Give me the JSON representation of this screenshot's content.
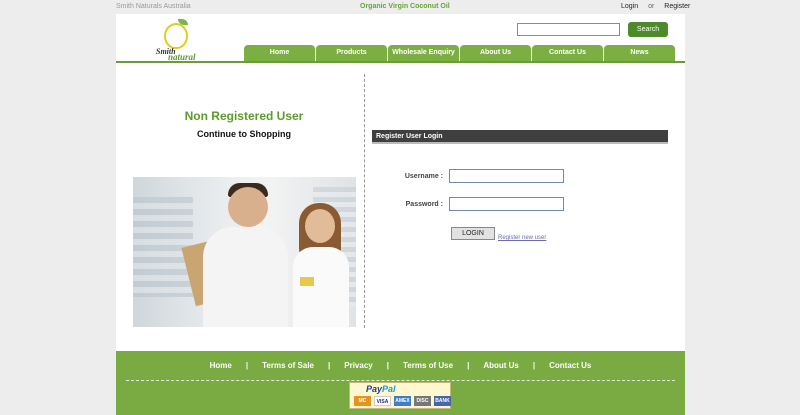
{
  "topbar": {
    "site_name": "Smith Naturals Australia",
    "tagline": "Organic Virgin Coconut Oil",
    "login": "Login",
    "or": "or",
    "register": "Register"
  },
  "logo": {
    "line1": "Smith",
    "line2": "natural"
  },
  "search": {
    "value": "",
    "placeholder": "",
    "button": "Search"
  },
  "nav": {
    "items": [
      {
        "label": "Home"
      },
      {
        "label": "Products"
      },
      {
        "label": "Wholesale Enquiry"
      },
      {
        "label": "About Us"
      },
      {
        "label": "Contact Us"
      },
      {
        "label": "News"
      }
    ]
  },
  "left": {
    "title": "Non Registered User",
    "subtitle": "Continue to Shopping"
  },
  "login": {
    "header": "Register User Login",
    "username_label": "Username :",
    "username_value": "",
    "password_label": "Password :",
    "password_value": "",
    "button": "LOGIN",
    "register_link": "Register new user"
  },
  "footer": {
    "links": [
      {
        "label": "Home"
      },
      {
        "label": "Terms of Sale"
      },
      {
        "label": "Privacy"
      },
      {
        "label": "Terms of Use"
      },
      {
        "label": "About Us"
      },
      {
        "label": "Contact Us"
      }
    ],
    "separator": "|",
    "paypal": {
      "brand_dark": "Pay",
      "brand_light": "Pal",
      "cards": [
        "MC",
        "VISA",
        "AMEX",
        "DISC",
        "BANK"
      ]
    }
  },
  "colors": {
    "brand_green": "#79ab42",
    "nav_green": "#7caf43",
    "title_green": "#5e9a2c",
    "header_dark": "#3f3f3f"
  }
}
